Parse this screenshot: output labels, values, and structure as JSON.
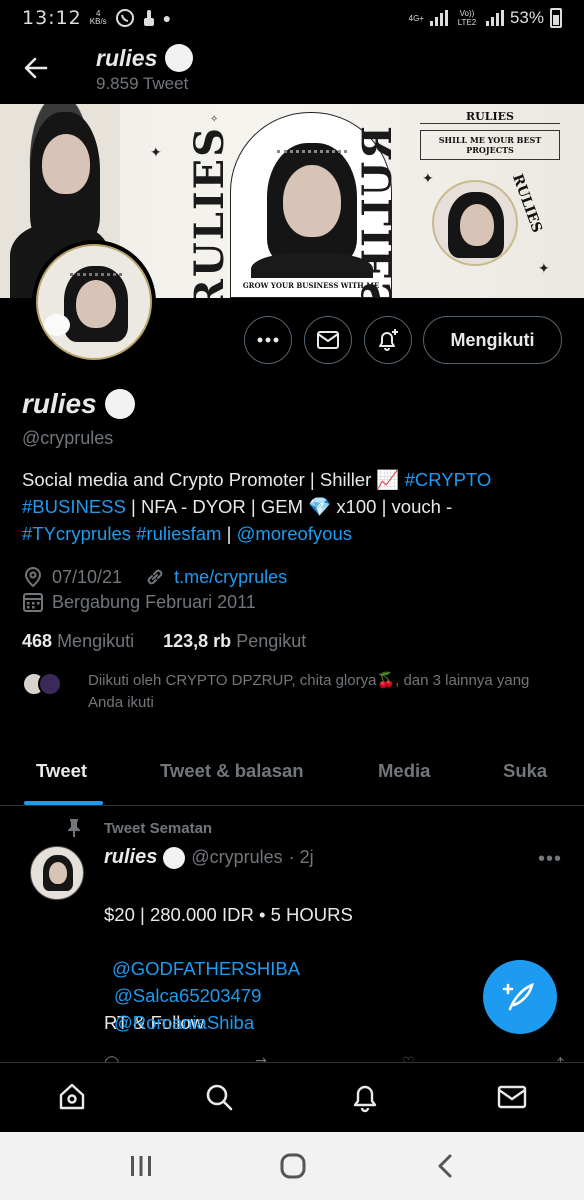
{
  "status_bar": {
    "time": "13:12",
    "net_speed": "4",
    "net_unit": "KB/s",
    "net_type": "4G+",
    "lte": "Vo)) LTE2",
    "battery": "53%"
  },
  "header": {
    "back_icon": "arrow-left-icon",
    "name": "rulies",
    "tweet_count": "9.859 Tweet"
  },
  "banner": {
    "word": "RULIES",
    "caption": "GROW YOUR BUSINESS WITH ME",
    "panel_title": "RULIES",
    "panel_text": "SHILL ME YOUR BEST PROJECTS",
    "panel_word": "RULIES"
  },
  "actions": {
    "more_icon": "more-horizontal-icon",
    "message_icon": "envelope-icon",
    "notify_icon": "bell-plus-icon",
    "follow_label": "Mengikuti"
  },
  "profile": {
    "name": "rulies",
    "handle": "@cryprules",
    "bio_text1": "Social media and Crypto Promoter | Shiller 📈 ",
    "bio_tag1": "#CRYPTO",
    "bio_tag2": "#BUSINESS",
    "bio_text2": " | NFA - DYOR | GEM 💎 x100 | vouch - ",
    "bio_tag3": "#TYcryprules",
    "bio_tag4": "#ruliesfam",
    "bio_text3": " | ",
    "bio_mention": "@moreofyous",
    "location": "07/10/21",
    "link": "t.me/cryprules",
    "joined": "Bergabung Februari 2011",
    "following_count": "468",
    "following_label": "Mengikuti",
    "followers_count": "123,8 rb",
    "followers_label": "Pengikut",
    "followed_by": "Diikuti oleh CRYPTO DPZRUP, chita glorya🍒, dan 3 lainnya yang Anda ikuti"
  },
  "tabs": [
    {
      "label": "Tweet"
    },
    {
      "label": "Tweet & balasan"
    },
    {
      "label": "Media"
    },
    {
      "label": "Suka"
    }
  ],
  "tweet": {
    "pinned_label": "Tweet Sematan",
    "name": "rulies",
    "handle": "@cryprules",
    "time": "· 2j",
    "line1": "$20 | 280.000 IDR • 5 HOURS",
    "line2": "RT & Follow",
    "mentions": [
      "@GODFATHERSHIBA",
      "@Salca65203479",
      "@RomaniaShiba"
    ]
  },
  "fab": {
    "icon": "compose-tweet-icon"
  },
  "bottom_nav": [
    {
      "icon": "home-icon"
    },
    {
      "icon": "search-icon"
    },
    {
      "icon": "notifications-icon"
    },
    {
      "icon": "messages-icon"
    }
  ],
  "colors": {
    "accent": "#1d9bf0",
    "background": "#000000",
    "muted": "#71767b",
    "text": "#e7e9ea"
  }
}
